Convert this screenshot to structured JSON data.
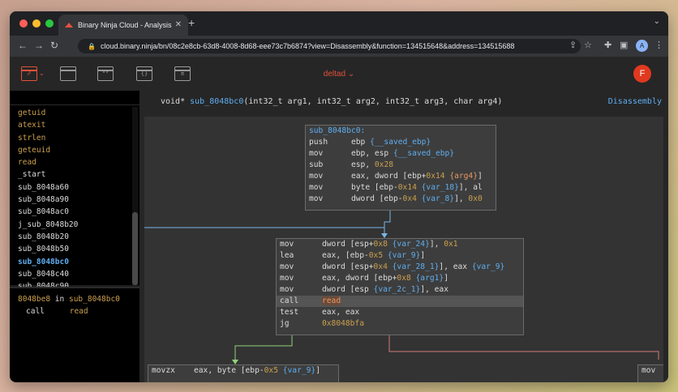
{
  "browser": {
    "tab_title": "Binary Ninja Cloud - Analysis",
    "tab_close": "✕",
    "new_tab": "+",
    "tabs_menu": "⌄",
    "url": "cloud.binary.ninja/bn/08c2e8cb-63d8-4008-8d68-eee73c7b6874?view=Disassembly&function=134515648&address=134515688",
    "avatar_letter": "A",
    "nav": {
      "back": "←",
      "forward": "→",
      "reload": "↻"
    },
    "ext_icons": {
      "share": "⇪",
      "star": "☆",
      "puzzle": "✚",
      "sidebar": "▣"
    }
  },
  "app": {
    "project_name": "deltad ⌄",
    "user_initial": "F",
    "header_icons": [
      "graph-icon",
      "window-icon",
      "strings-icon",
      "braces-icon",
      "log-icon",
      "list-icon"
    ],
    "header_icon_glyphs": {
      "strings": "\"\"",
      "braces": "{}"
    }
  },
  "sidebar": {
    "symbols": [
      {
        "label": "getuid",
        "kind": "import"
      },
      {
        "label": "atexit",
        "kind": "import"
      },
      {
        "label": "strlen",
        "kind": "import"
      },
      {
        "label": "geteuid",
        "kind": "import"
      },
      {
        "label": "read",
        "kind": "import"
      },
      {
        "label": "_start",
        "kind": "plain"
      },
      {
        "label": "sub_8048a60",
        "kind": "plain"
      },
      {
        "label": "sub_8048a90",
        "kind": "plain"
      },
      {
        "label": "sub_8048ac0",
        "kind": "plain"
      },
      {
        "label": "j_sub_8048b20",
        "kind": "plain"
      },
      {
        "label": "sub_8048b20",
        "kind": "plain"
      },
      {
        "label": "sub_8048b50",
        "kind": "plain"
      },
      {
        "label": "sub_8048bc0",
        "kind": "selected"
      },
      {
        "label": "sub_8048c40",
        "kind": "plain"
      },
      {
        "label": "sub_8048c90",
        "kind": "plain"
      }
    ],
    "xref": {
      "address": "8048be8",
      "in_word": "in",
      "function": "sub_8048bc0",
      "instr": "call",
      "target": "read"
    }
  },
  "main": {
    "signature_prefix": "void* ",
    "function_name": "sub_8048bc0",
    "signature_args": "(int32_t arg1, int32_t arg2, int32_t arg3, char arg4)",
    "view_mode": "Disassembly",
    "block1": {
      "label": "sub_8048bc0:",
      "lines": [
        {
          "m": "push",
          "o": [
            [
              "ebp ",
              ""
            ],
            [
              "{__saved_ebp}",
              "var"
            ]
          ]
        },
        {
          "m": "mov",
          "o": [
            [
              "ebp, esp ",
              ""
            ],
            [
              "{__saved_ebp}",
              "var"
            ]
          ]
        },
        {
          "m": "sub",
          "o": [
            [
              "esp, ",
              ""
            ],
            [
              "0x28",
              "num"
            ]
          ]
        },
        {
          "m": "mov",
          "o": [
            [
              "eax, dword [ebp+",
              ""
            ],
            [
              "0x14",
              "num"
            ],
            [
              " ",
              ""
            ],
            [
              "{arg4}",
              "sym"
            ],
            [
              "]",
              ""
            ]
          ]
        },
        {
          "m": "mov",
          "o": [
            [
              "byte [ebp-",
              ""
            ],
            [
              "0x14",
              "num"
            ],
            [
              " ",
              ""
            ],
            [
              "{var_18}",
              "var"
            ],
            [
              "], al",
              ""
            ]
          ]
        },
        {
          "m": "mov",
          "o": [
            [
              "dword [ebp-",
              ""
            ],
            [
              "0x4",
              "num"
            ],
            [
              " ",
              ""
            ],
            [
              "{var_8}",
              "var"
            ],
            [
              "], ",
              ""
            ],
            [
              "0x0",
              "num"
            ]
          ]
        }
      ]
    },
    "block2": {
      "lines": [
        {
          "m": "mov",
          "o": [
            [
              "dword [esp+",
              ""
            ],
            [
              "0x8",
              "num"
            ],
            [
              " ",
              ""
            ],
            [
              "{var_24}",
              "var"
            ],
            [
              "], ",
              ""
            ],
            [
              "0x1",
              "num"
            ]
          ]
        },
        {
          "m": "lea",
          "o": [
            [
              "eax, [ebp-",
              ""
            ],
            [
              "0x5",
              "num"
            ],
            [
              " ",
              ""
            ],
            [
              "{var_9}",
              "var"
            ],
            [
              "]",
              ""
            ]
          ]
        },
        {
          "m": "mov",
          "o": [
            [
              "dword [esp+",
              ""
            ],
            [
              "0x4",
              "num"
            ],
            [
              " ",
              ""
            ],
            [
              "{var_28_1}",
              "var"
            ],
            [
              "], eax ",
              ""
            ],
            [
              "{var_9}",
              "var"
            ]
          ]
        },
        {
          "m": "mov",
          "o": [
            [
              "eax, dword [ebp+",
              ""
            ],
            [
              "0x8",
              "num"
            ],
            [
              " ",
              ""
            ],
            [
              "{arg1}",
              "var"
            ],
            [
              "]",
              ""
            ]
          ]
        },
        {
          "m": "mov",
          "o": [
            [
              "dword [esp ",
              ""
            ],
            [
              "{var_2c_1}",
              "var"
            ],
            [
              "], eax",
              ""
            ]
          ]
        },
        {
          "m": "call",
          "o": [
            [
              "read",
              "sym-hl"
            ]
          ],
          "highlight": true
        },
        {
          "m": "test",
          "o": [
            [
              "eax, eax",
              ""
            ]
          ]
        },
        {
          "m": "jg",
          "o": [
            [
              "0x8048bfa",
              "num"
            ]
          ]
        }
      ]
    },
    "block3": {
      "lines": [
        {
          "m": "movzx",
          "o": [
            [
              "eax, byte [ebp-",
              ""
            ],
            [
              "0x5",
              "num"
            ],
            [
              " ",
              ""
            ],
            [
              "{var_9}",
              "var"
            ],
            [
              "]",
              ""
            ]
          ]
        }
      ]
    },
    "block4": {
      "lines": [
        {
          "m": "mov",
          "o": []
        }
      ]
    },
    "colors": {
      "edge_blue": "#7ab6e8",
      "edge_green": "#8fd07a",
      "edge_red": "#d07a7a"
    }
  }
}
